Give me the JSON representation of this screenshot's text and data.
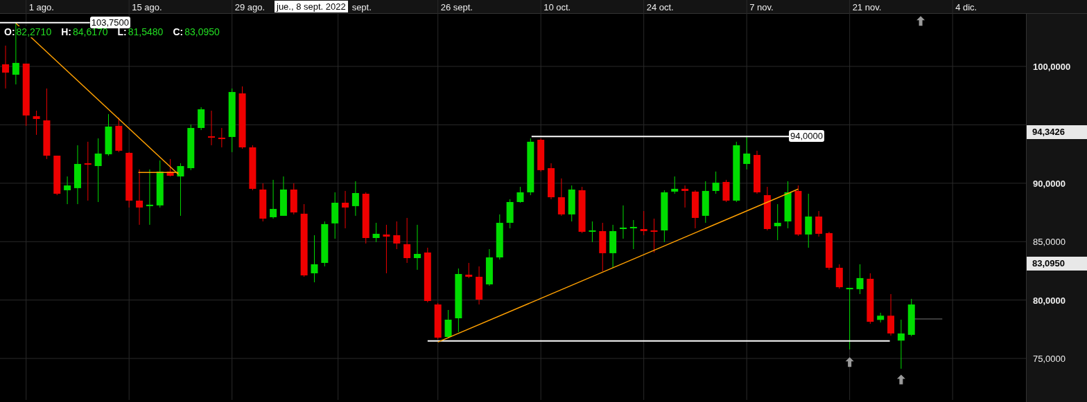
{
  "legend": [
    {
      "key": "O:",
      "value": "82,2710"
    },
    {
      "key": "H:",
      "value": "84,6170"
    },
    {
      "key": "L:",
      "value": "81,5480"
    },
    {
      "key": "C:",
      "value": "83,0950"
    }
  ],
  "crosshair_label": "jue., 8 sept. 2022",
  "date_axis": {
    "labels": [
      "1 ago.",
      "15 ago.",
      "29 ago.",
      "sept.",
      "26 sept.",
      "10 oct.",
      "24 oct.",
      "7 nov.",
      "21 nov.",
      "4 dic."
    ]
  },
  "price_axis": {
    "labels": [
      "100,0000",
      "90,0000",
      "85,0000",
      "80,0000",
      "75,0000"
    ],
    "markers": [
      "94,3426",
      "83,0950"
    ]
  },
  "level_labels": [
    "103,7500",
    "94,0000"
  ]
}
